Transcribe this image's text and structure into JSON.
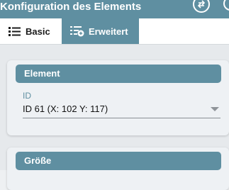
{
  "header": {
    "title": "Konfiguration des Elements",
    "swap_icon": "swap-arrows-icon",
    "partial_icon": "circle-icon"
  },
  "tabs": [
    {
      "label": "Basic",
      "icon": "list-icon",
      "active": false
    },
    {
      "label": "Erweitert",
      "icon": "list-add-icon",
      "active": true
    }
  ],
  "element_card": {
    "title": "Element",
    "field_label": "ID",
    "field_value": "ID 61 (X: 102 Y: 117)"
  },
  "size_card": {
    "title": "Größe"
  },
  "colors": {
    "accent": "#5f8fa1",
    "background": "#e6e9ec"
  }
}
